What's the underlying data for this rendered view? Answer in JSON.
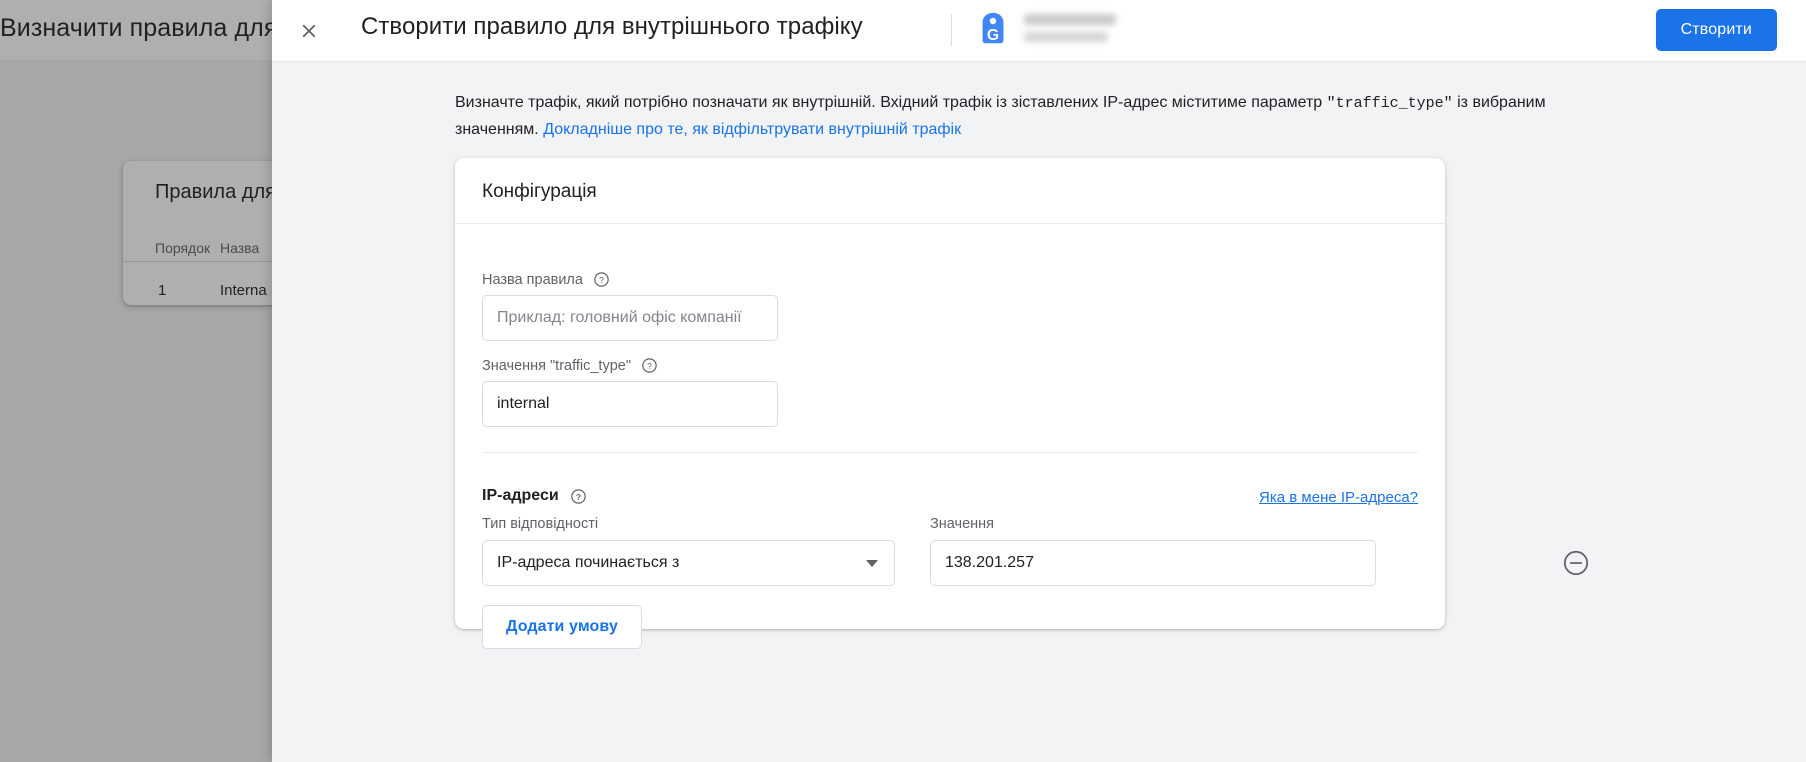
{
  "background": {
    "page_title": "Визначити правила для",
    "card_title": "Правила для",
    "columns": [
      "Порядок",
      "Назва",
      ""
    ],
    "rows": [
      {
        "order": "1",
        "name": "Interna",
        "extra": ""
      }
    ]
  },
  "modal": {
    "close_icon": "close-icon",
    "title": "Створити правило для внутрішнього трафіку",
    "account_icon": "google-analytics-tag-icon",
    "property_name": "",
    "create_label": "Створити",
    "description": {
      "part1": "Визначте трафік, який потрібно позначати як внутрішній. Вхідний трафік із зіставлених IP-адрес міститиме параметр ",
      "code": "\"traffic_type\"",
      "part2": " із вибраним значенням. ",
      "link": "Докладніше про те, як відфільтрувати внутрішній трафік"
    },
    "config": {
      "title": "Конфігурація",
      "rule_name": {
        "label": "Назва правила",
        "help_icon": "help-circle-icon",
        "value": "",
        "placeholder": "Приклад: головний офіс компанії"
      },
      "traffic_type": {
        "label": "Значення \"traffic_type\"",
        "help_icon": "help-circle-icon",
        "value": "internal",
        "placeholder": ""
      },
      "ip_section": {
        "title": "IP-адреси",
        "help_icon": "help-circle-icon",
        "my_ip_link": "Яка в мене IP-адреса?",
        "match_type_label": "Тип відповідності",
        "match_type_value": "IP-адреса починається з",
        "value_label": "Значення",
        "value": "138.201.257",
        "remove_icon": "remove-circle-icon",
        "add_condition_label": "Додати умову"
      }
    }
  },
  "colors": {
    "accent": "#1a73e8",
    "surface": "#f1f3f4",
    "text": "#202124",
    "muted": "#5f6368"
  }
}
